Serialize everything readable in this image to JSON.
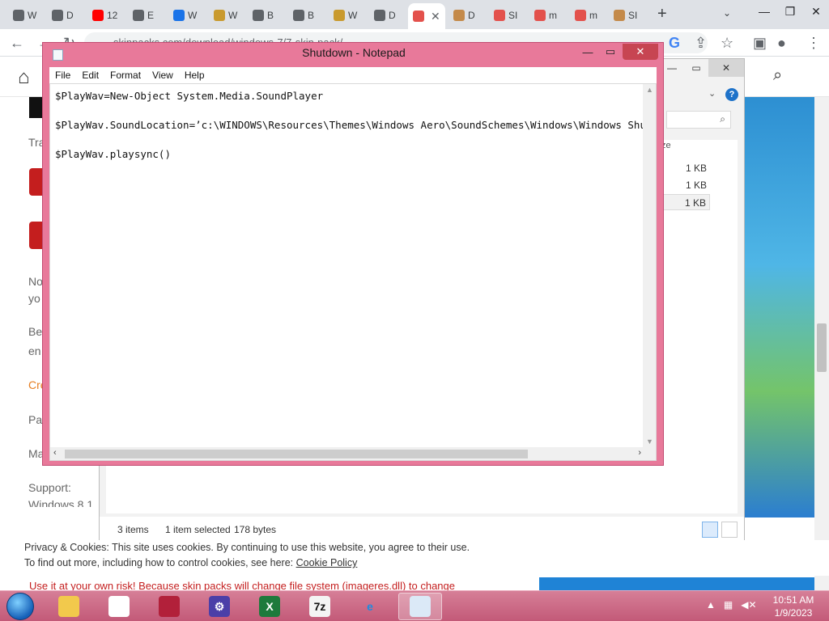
{
  "chrome": {
    "tabs": [
      {
        "label": "W",
        "icon": "chrome-icon",
        "color": "#5f6368"
      },
      {
        "label": "D",
        "icon": "globe-icon",
        "color": "#5f6368"
      },
      {
        "label": "12",
        "icon": "youtube-icon",
        "color": "#ff0000"
      },
      {
        "label": "E",
        "icon": "globe-icon",
        "color": "#5f6368"
      },
      {
        "label": "W",
        "icon": "edge-icon",
        "color": "#1a73e8"
      },
      {
        "label": "W",
        "icon": "note-icon",
        "color": "#c99a2e"
      },
      {
        "label": "B",
        "icon": "globe-icon",
        "color": "#5f6368"
      },
      {
        "label": "B",
        "icon": "globe-icon",
        "color": "#5f6368"
      },
      {
        "label": "W",
        "icon": "note-icon",
        "color": "#c99a2e"
      },
      {
        "label": "D",
        "icon": "download-icon",
        "color": "#5f6368"
      },
      {
        "label": "",
        "icon": "skinpacks-icon",
        "color": "#e3514c",
        "active": true
      },
      {
        "label": "D",
        "icon": "swirl-icon",
        "color": "#c48a4a"
      },
      {
        "label": "SI",
        "icon": "skinpacks-icon",
        "color": "#e3514c"
      },
      {
        "label": "m",
        "icon": "skinpacks-icon",
        "color": "#e3514c"
      },
      {
        "label": "m",
        "icon": "skinpacks-icon",
        "color": "#e3514c"
      },
      {
        "label": "SI",
        "icon": "swirl-icon",
        "color": "#c48a4a"
      }
    ],
    "url": "skinpacks.com/download/windows-7/7-skin-pack/"
  },
  "page": {
    "peek_lines": [
      {
        "text": "Tra",
        "link": false
      },
      {
        "text": "No",
        "link": false
      },
      {
        "text": "yo",
        "link": false
      },
      {
        "text": "Be",
        "link": false
      },
      {
        "text": "en",
        "link": false
      },
      {
        "text": "Cre",
        "link": true
      },
      {
        "text": "Pa",
        "link": false
      },
      {
        "text": "Ma",
        "link": false
      },
      {
        "text": "Support:",
        "link": false
      },
      {
        "text": "Windows 8.1",
        "link": false
      }
    ],
    "below_text": "Use it at your own risk! Because skin packs will change file system (imageres.dll) to change"
  },
  "explorer": {
    "size_header": "ze",
    "sizes": [
      "1 KB",
      "1 KB",
      "1 KB"
    ],
    "status_items": "3 items",
    "status_selected": "1 item selected",
    "status_size": "178 bytes"
  },
  "notepad": {
    "title": "Shutdown - Notepad",
    "menu": [
      "File",
      "Edit",
      "Format",
      "View",
      "Help"
    ],
    "content": "$PlayWav=New-Object System.Media.SoundPlayer\n\n$PlayWav.SoundLocation=’c:\\WINDOWS\\Resources\\Themes\\Windows Aero\\SoundSchemes\\Windows\\Windows Shutdown.wav’\n\n$PlayWav.playsync()",
    "scroll_fraction": 0.82
  },
  "cookie": {
    "line1": "Privacy & Cookies: This site uses cookies. By continuing to use this website, you agree to their use.",
    "line2_prefix": "To find out more, including how to control cookies, see here: ",
    "link": "Cookie Policy"
  },
  "taskbar": {
    "apps": [
      {
        "name": "explorer-taskbar-button",
        "icon": "folder-icon",
        "label": "",
        "bg": "#f2c94c",
        "fg": "#7a5a00"
      },
      {
        "name": "chrome-taskbar-button",
        "icon": "chrome-icon",
        "label": "",
        "bg": "#ffffff",
        "fg": "#db4437"
      },
      {
        "name": "recorder-taskbar-button",
        "icon": "recorder-icon",
        "label": "",
        "bg": "#b2203a",
        "fg": "#ffffff"
      },
      {
        "name": "settings-taskbar-button",
        "icon": "gear-icon",
        "label": "⚙",
        "bg": "#4b3fa8",
        "fg": "#ffffff"
      },
      {
        "name": "excel-taskbar-button",
        "icon": "excel-icon",
        "label": "X",
        "bg": "#1e7a3c",
        "fg": "#ffffff"
      },
      {
        "name": "7zip-taskbar-button",
        "icon": "7zip-icon",
        "label": "7z",
        "bg": "#f4f4f4",
        "fg": "#111111"
      },
      {
        "name": "ie-taskbar-button",
        "icon": "internet-explorer-icon",
        "label": "e",
        "bg": "transparent",
        "fg": "#1b8ce0"
      },
      {
        "name": "notepad-taskbar-button",
        "icon": "notepad-icon",
        "label": "",
        "bg": "#dbe9f7",
        "fg": "#4a6d9a",
        "active": true
      }
    ],
    "time": "10:51 AM",
    "date": "1/9/2023"
  }
}
